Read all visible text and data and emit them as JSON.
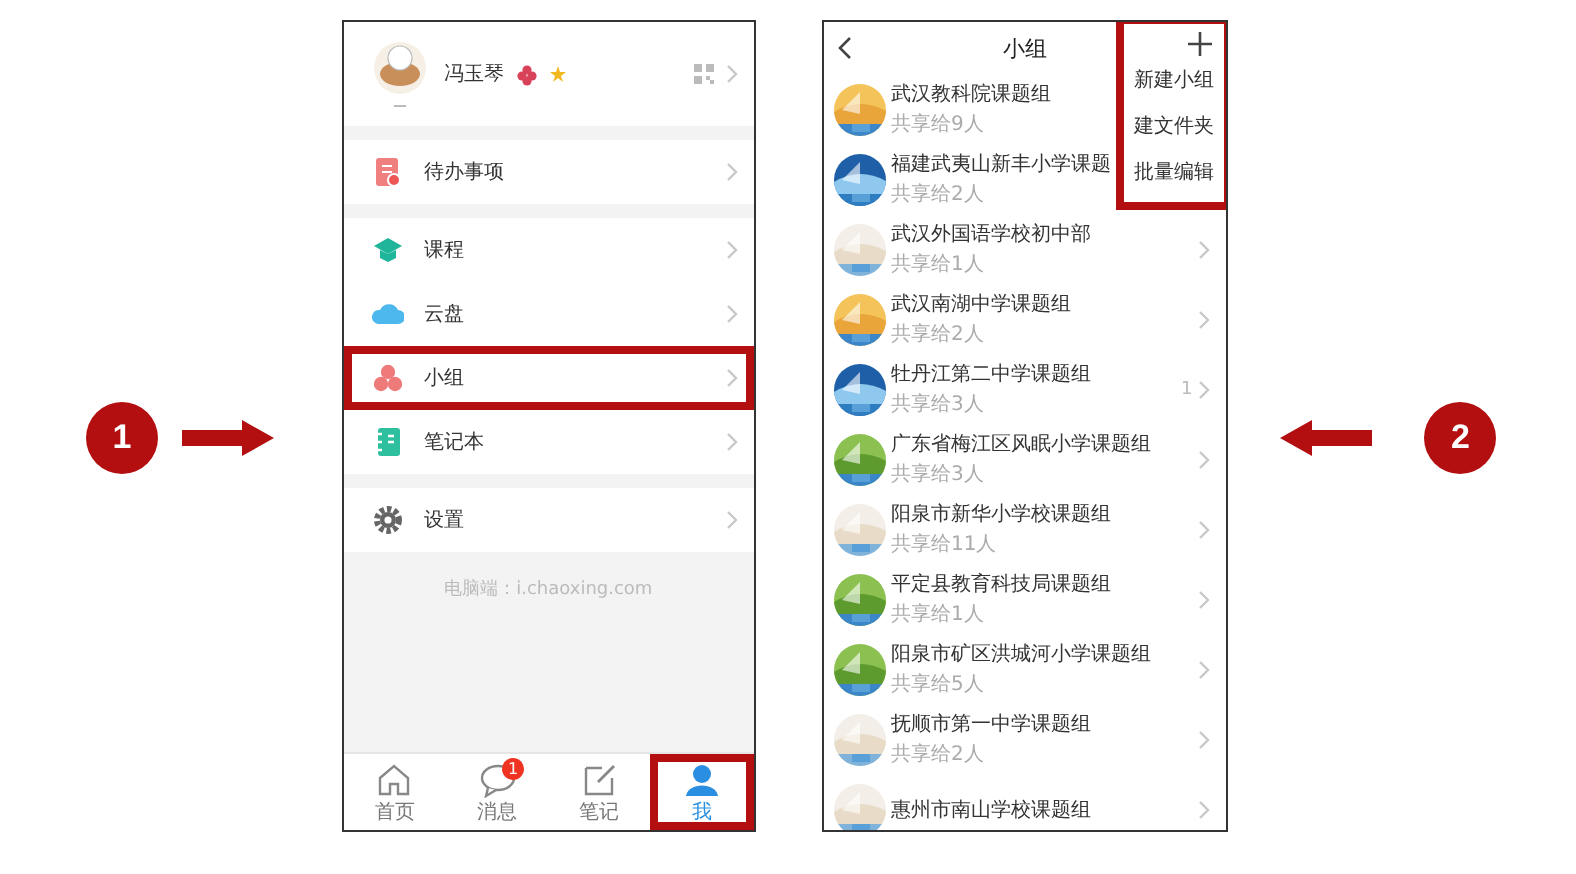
{
  "steps": [
    {
      "label": "1"
    },
    {
      "label": "2"
    }
  ],
  "profile_screen": {
    "user": {
      "name": "冯玉琴"
    },
    "menu_groups": [
      [
        {
          "label": "待办事项",
          "highlighted": false
        }
      ],
      [
        {
          "label": "课程",
          "highlighted": false
        },
        {
          "label": "云盘",
          "highlighted": false
        },
        {
          "label": "小组",
          "highlighted": true
        },
        {
          "label": "笔记本",
          "highlighted": false
        }
      ],
      [
        {
          "label": "设置",
          "highlighted": false
        }
      ]
    ],
    "footer": "电脑端：i.chaoxing.com",
    "tabs": [
      {
        "label": "首页",
        "selected": false,
        "highlighted": false
      },
      {
        "label": "消息",
        "badge": "1",
        "selected": false,
        "highlighted": false
      },
      {
        "label": "笔记",
        "selected": false,
        "highlighted": false
      },
      {
        "label": "我",
        "selected": true,
        "highlighted": true
      }
    ]
  },
  "group_screen": {
    "title": "小组",
    "menu": {
      "highlighted": true,
      "items": [
        "新建小组",
        "建文件夹",
        "批量编辑"
      ]
    },
    "groups": [
      {
        "name": "武汉教科院课题组",
        "shared": "共享给9人"
      },
      {
        "name": "福建武夷山新丰小学课题",
        "shared": "共享给2人"
      },
      {
        "name": "武汉外国语学校初中部",
        "shared": "共享给1人"
      },
      {
        "name": "武汉南湖中学课题组",
        "shared": "共享给2人"
      },
      {
        "name": "牡丹江第二中学课题组",
        "shared": "共享给3人",
        "count": "1"
      },
      {
        "name": "广东省梅江区风眠小学课题组",
        "shared": "共享给3人"
      },
      {
        "name": "阳泉市新华小学校课题组",
        "shared": "共享给11人"
      },
      {
        "name": "平定县教育科技局课题组",
        "shared": "共享给1人"
      },
      {
        "name": "阳泉市矿区洪城河小学课题组",
        "shared": "共享给5人"
      },
      {
        "name": "抚顺市第一中学课题组",
        "shared": "共享给2人"
      },
      {
        "name": "惠州市南山学校课题组"
      }
    ]
  }
}
